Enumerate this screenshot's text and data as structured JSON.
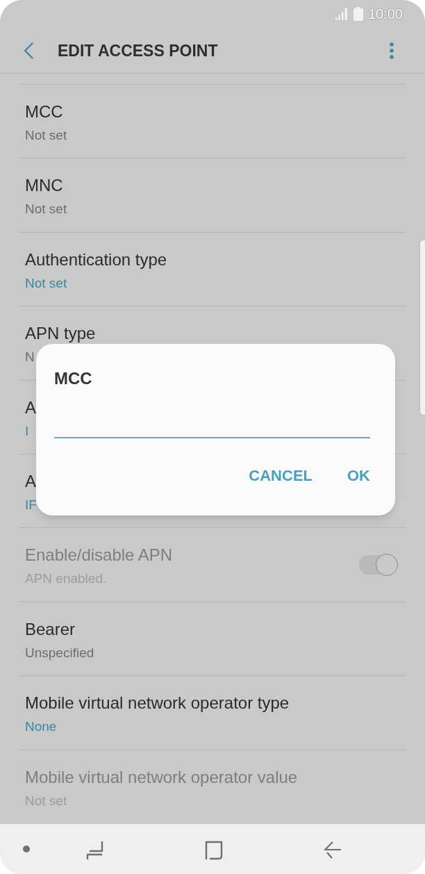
{
  "status_bar": {
    "time": "10:00"
  },
  "header": {
    "title": "EDIT ACCESS POINT"
  },
  "rows": [
    {
      "kind": "text",
      "title": "MCC",
      "value": "Not set",
      "disabled": false
    },
    {
      "kind": "text",
      "title": "MNC",
      "value": "Not set",
      "disabled": false
    },
    {
      "kind": "list",
      "title": "Authentication type",
      "value": "Not set",
      "disabled": false
    },
    {
      "kind": "text",
      "title": "APN type",
      "value": "N",
      "disabled": false
    },
    {
      "kind": "list",
      "title": "A",
      "value": "I",
      "disabled": false
    },
    {
      "kind": "list",
      "title": "A",
      "value": "IF",
      "disabled": false
    },
    {
      "kind": "toggle",
      "title": "Enable/disable APN",
      "value": "APN enabled.",
      "disabled": true,
      "on": true
    },
    {
      "kind": "text",
      "title": "Bearer",
      "value": "Unspecified",
      "disabled": false
    },
    {
      "kind": "list",
      "title": "Mobile virtual network operator type",
      "value": "None",
      "disabled": false
    },
    {
      "kind": "text",
      "title": "Mobile virtual network operator value",
      "value": "Not set",
      "disabled": true
    }
  ],
  "dialog": {
    "title": "MCC",
    "buttons": [
      "CANCEL",
      "OK"
    ]
  }
}
